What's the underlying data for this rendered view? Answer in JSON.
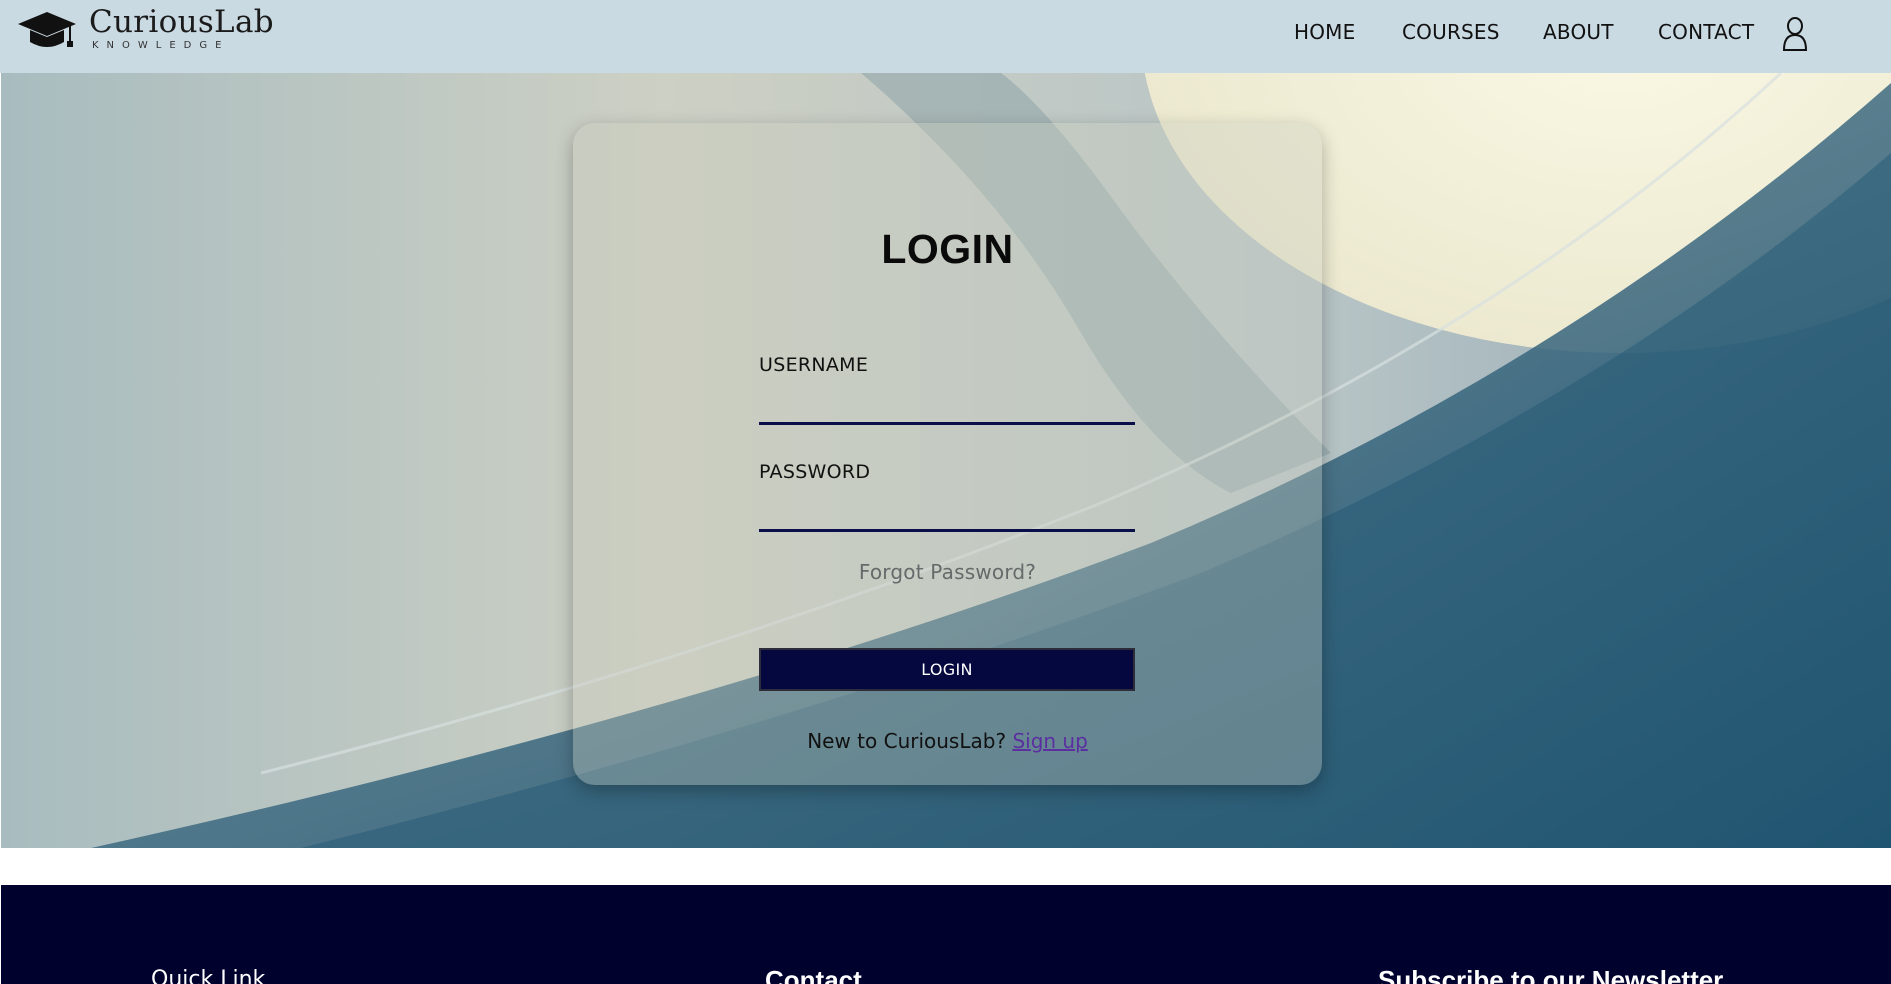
{
  "brand": {
    "name": "CuriousLab",
    "tagline": "KNOWLEDGE",
    "icon": "graduation-cap-icon"
  },
  "nav": {
    "items": [
      {
        "label": "HOME"
      },
      {
        "label": "COURSES"
      },
      {
        "label": "ABOUT"
      },
      {
        "label": "CONTACT"
      }
    ],
    "user_icon": "user-icon"
  },
  "login": {
    "title": "LOGIN",
    "username_label": "USERNAME",
    "username_value": "",
    "password_label": "PASSWORD",
    "password_value": "",
    "forgot": "Forgot Password?",
    "button": "LOGIN",
    "signup_prompt": "New to CuriousLab?",
    "signup_link": "Sign up"
  },
  "footer": {
    "col1": "Quick Link",
    "col2": "Contact",
    "col3": "Subscribe to our Newsletter"
  },
  "colors": {
    "header_bg": "#cadae3",
    "button_bg": "#05073f",
    "footer_bg": "#01012e",
    "link": "#5b2fa0"
  }
}
